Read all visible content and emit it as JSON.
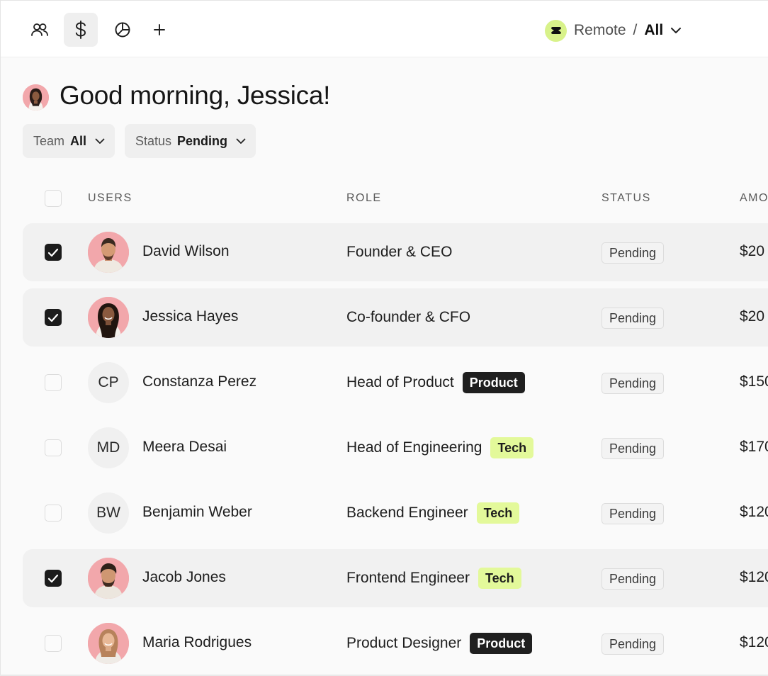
{
  "nav": {
    "items": [
      {
        "icon": "people-icon",
        "active": false
      },
      {
        "icon": "dollar-icon",
        "active": true
      },
      {
        "icon": "pie-chart-icon",
        "active": false
      },
      {
        "icon": "plus-icon",
        "active": false
      }
    ]
  },
  "workspace": {
    "name": "Remote",
    "separator": "/",
    "scope": "All",
    "logo_color": "#d8f28a"
  },
  "greeting": "Good morning, Jessica!",
  "filters": [
    {
      "label": "Team",
      "value": "All"
    },
    {
      "label": "Status",
      "value": "Pending"
    }
  ],
  "table": {
    "headers": {
      "users": "USERS",
      "role": "ROLE",
      "status": "STATUS",
      "amount": "AMO"
    },
    "rows": [
      {
        "name": "David Wilson",
        "avatar": "photo",
        "initials": "",
        "role": "Founder & CEO",
        "tag": "",
        "tag_style": "",
        "status": "Pending",
        "amount": "$20",
        "checked": true
      },
      {
        "name": "Jessica Hayes",
        "avatar": "photo",
        "initials": "",
        "role": "Co-founder & CFO",
        "tag": "",
        "tag_style": "",
        "status": "Pending",
        "amount": "$20",
        "checked": true
      },
      {
        "name": "Constanza Perez",
        "avatar": "initials",
        "initials": "CP",
        "role": "Head of Product",
        "tag": "Product",
        "tag_style": "dark",
        "status": "Pending",
        "amount": "$150",
        "checked": false
      },
      {
        "name": "Meera Desai",
        "avatar": "initials",
        "initials": "MD",
        "role": "Head of Engineering",
        "tag": "Tech",
        "tag_style": "lime",
        "status": "Pending",
        "amount": "$170",
        "checked": false
      },
      {
        "name": "Benjamin Weber",
        "avatar": "initials",
        "initials": "BW",
        "role": "Backend Engineer",
        "tag": "Tech",
        "tag_style": "lime",
        "status": "Pending",
        "amount": "$120",
        "checked": false
      },
      {
        "name": "Jacob Jones",
        "avatar": "photo",
        "initials": "",
        "role": "Frontend Engineer",
        "tag": "Tech",
        "tag_style": "lime",
        "status": "Pending",
        "amount": "$120",
        "checked": true
      },
      {
        "name": "Maria Rodrigues",
        "avatar": "photo",
        "initials": "",
        "role": "Product Designer",
        "tag": "Product",
        "tag_style": "dark",
        "status": "Pending",
        "amount": "$120",
        "checked": false
      }
    ]
  },
  "colors": {
    "tag_dark": "#1f1f1f",
    "tag_lime": "#e3f99a",
    "avatar_photo_bg": "#f2a7ab",
    "selected_row_bg": "#f1f1f1"
  }
}
